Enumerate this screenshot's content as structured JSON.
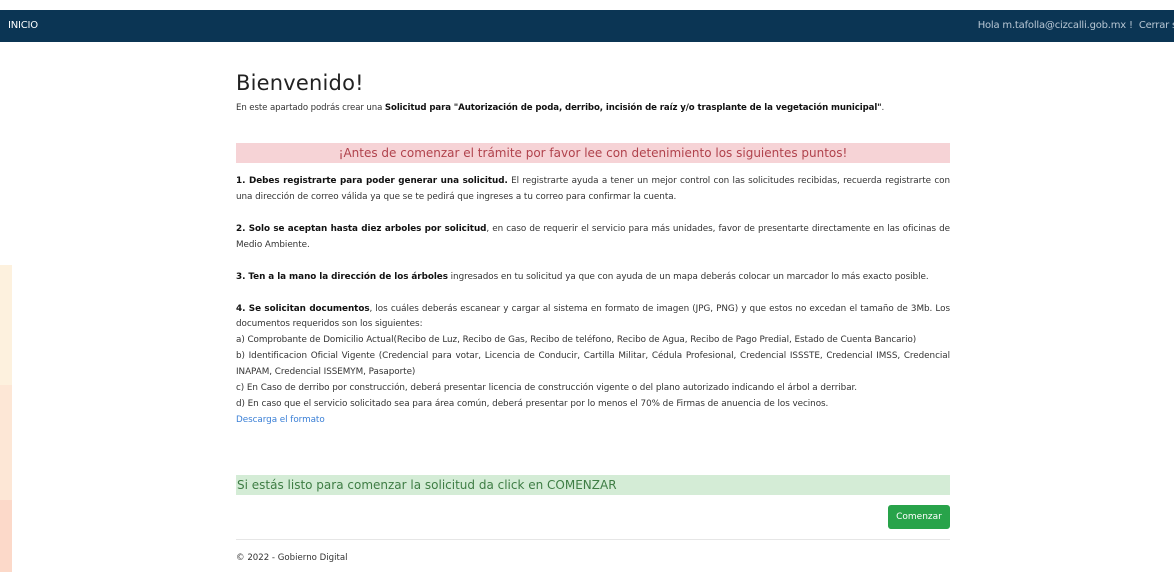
{
  "navbar": {
    "brand": "INICIO",
    "greeting": "Hola m.tafolla@cizcalli.gob.mx !",
    "logout": "Cerrar ses"
  },
  "main": {
    "title": "Bienvenido!",
    "intro_prefix": "En este apartado podrás crear una ",
    "intro_bold": "Solicitud para \"Autorización de poda, derribo, incisión de raíz y/o trasplante de la vegetación municipal\"",
    "intro_suffix": ".",
    "warning": "¡Antes de comenzar el trámite por favor lee con detenimiento los siguientes puntos!",
    "points": [
      {
        "bold": "1. Debes registrarte para poder generar una solicitud.",
        "text": " El registrarte ayuda a tener un mejor control con las solicitudes recibidas, recuerda registrarte con una dirección de correo válida ya que se te pedirá que ingreses a tu correo para confirmar la cuenta."
      },
      {
        "bold": "2. Solo se aceptan hasta diez arboles por solicitud",
        "text": ", en caso de requerir el servicio para más unidades, favor de presentarte directamente en las oficinas de Medio Ambiente."
      },
      {
        "bold": "3. Ten a la mano la dirección de los árboles",
        "text": " ingresados en tu solicitud ya que con ayuda de un mapa deberás colocar un marcador lo más exacto posible."
      },
      {
        "bold": "4. Se solicitan documentos",
        "text": ", los cuáles deberás escanear y cargar al sistema en formato de imagen (JPG, PNG) y que estos no excedan el tamaño de 3Mb. Los documentos requeridos son los siguientes:"
      }
    ],
    "documents": [
      "a) Comprobante de Domicilio Actual(Recibo de Luz, Recibo de Gas, Recibo de teléfono, Recibo de Agua, Recibo de Pago Predial, Estado de Cuenta Bancario)",
      "b) Identificacion Oficial Vigente (Credencial para votar, Licencia de Conducir, Cartilla Militar, Cédula Profesional, Credencial ISSSTE, Credencial IMSS, Credencial INAPAM, Credencial ISSEMYM, Pasaporte)",
      "c) En Caso de derribo por construcción, deberá presentar licencia de construcción vigente o del plano autorizado indicando el árbol a derribar.",
      "d) En caso que el servicio solicitado sea para área común, deberá presentar por lo menos el 70% de Firmas de anuencia de los vecinos."
    ],
    "download_link": "Descarga el formato",
    "ready_message": "Si estás listo para comenzar la solicitud da click en COMENZAR",
    "start_button": "Comenzar"
  },
  "footer": {
    "copyright": "© 2022 - Gobierno Digital"
  },
  "colors": {
    "navbar": "#0b3554",
    "warning_bg": "#f6d3d6",
    "warning_text": "#b0424c",
    "success_bg": "#d4ecd6",
    "success_text": "#3e7d44",
    "button": "#28a34a",
    "link": "#3a7fd6"
  }
}
